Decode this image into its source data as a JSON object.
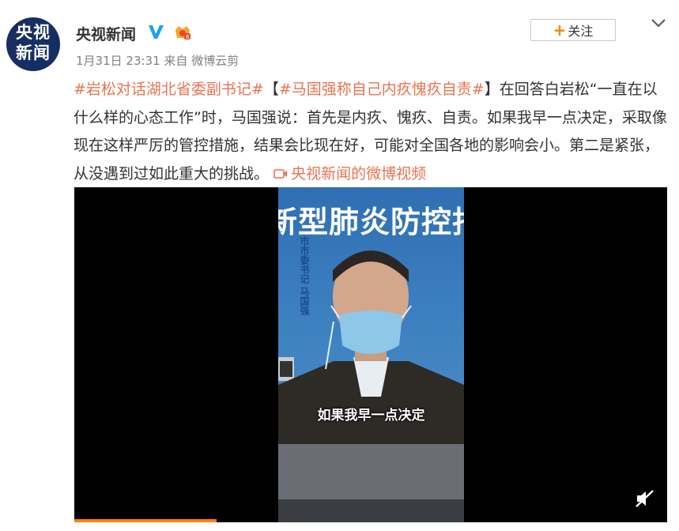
{
  "author": {
    "name": "央视新闻",
    "avatar_text_line1": "央视",
    "avatar_text_line2": "新闻"
  },
  "follow_button": {
    "label": "关注"
  },
  "meta": {
    "time": "1月31日 23:31",
    "source_prefix": "来自",
    "source": "微博云剪"
  },
  "post": {
    "tag1": "#岩松对话湖北省委副书记#",
    "tag2_open": "【",
    "tag2": "#马国强称自己内疚愧疚自责#",
    "tag2_close": "】",
    "body": "在回答白岩松“一直在以什么样的心态工作”时，马国强说：首先是内疚、愧疚、自责。如果我早一点决定，采取像现在这样严厉的管控措施，结果会比现在好，可能对全国各地的影响会小。第二是紧张，从没遇到过如此重大的挑战。",
    "video_link": "央视新闻的微博视频"
  },
  "video": {
    "banner_text": "新型肺炎防控指",
    "nameplate": "市市委书记 马国强",
    "subtitle": "如果我早一点决定",
    "progress": 0.24
  },
  "colors": {
    "link": "#eb7350",
    "verified": "#1da1f2",
    "follow_plus": "#ff8200",
    "avatar_bg": "#172e63"
  },
  "icons": [
    "verified-icon",
    "member-badge-icon",
    "chevron-down-icon",
    "video-link-icon",
    "mute-icon"
  ]
}
